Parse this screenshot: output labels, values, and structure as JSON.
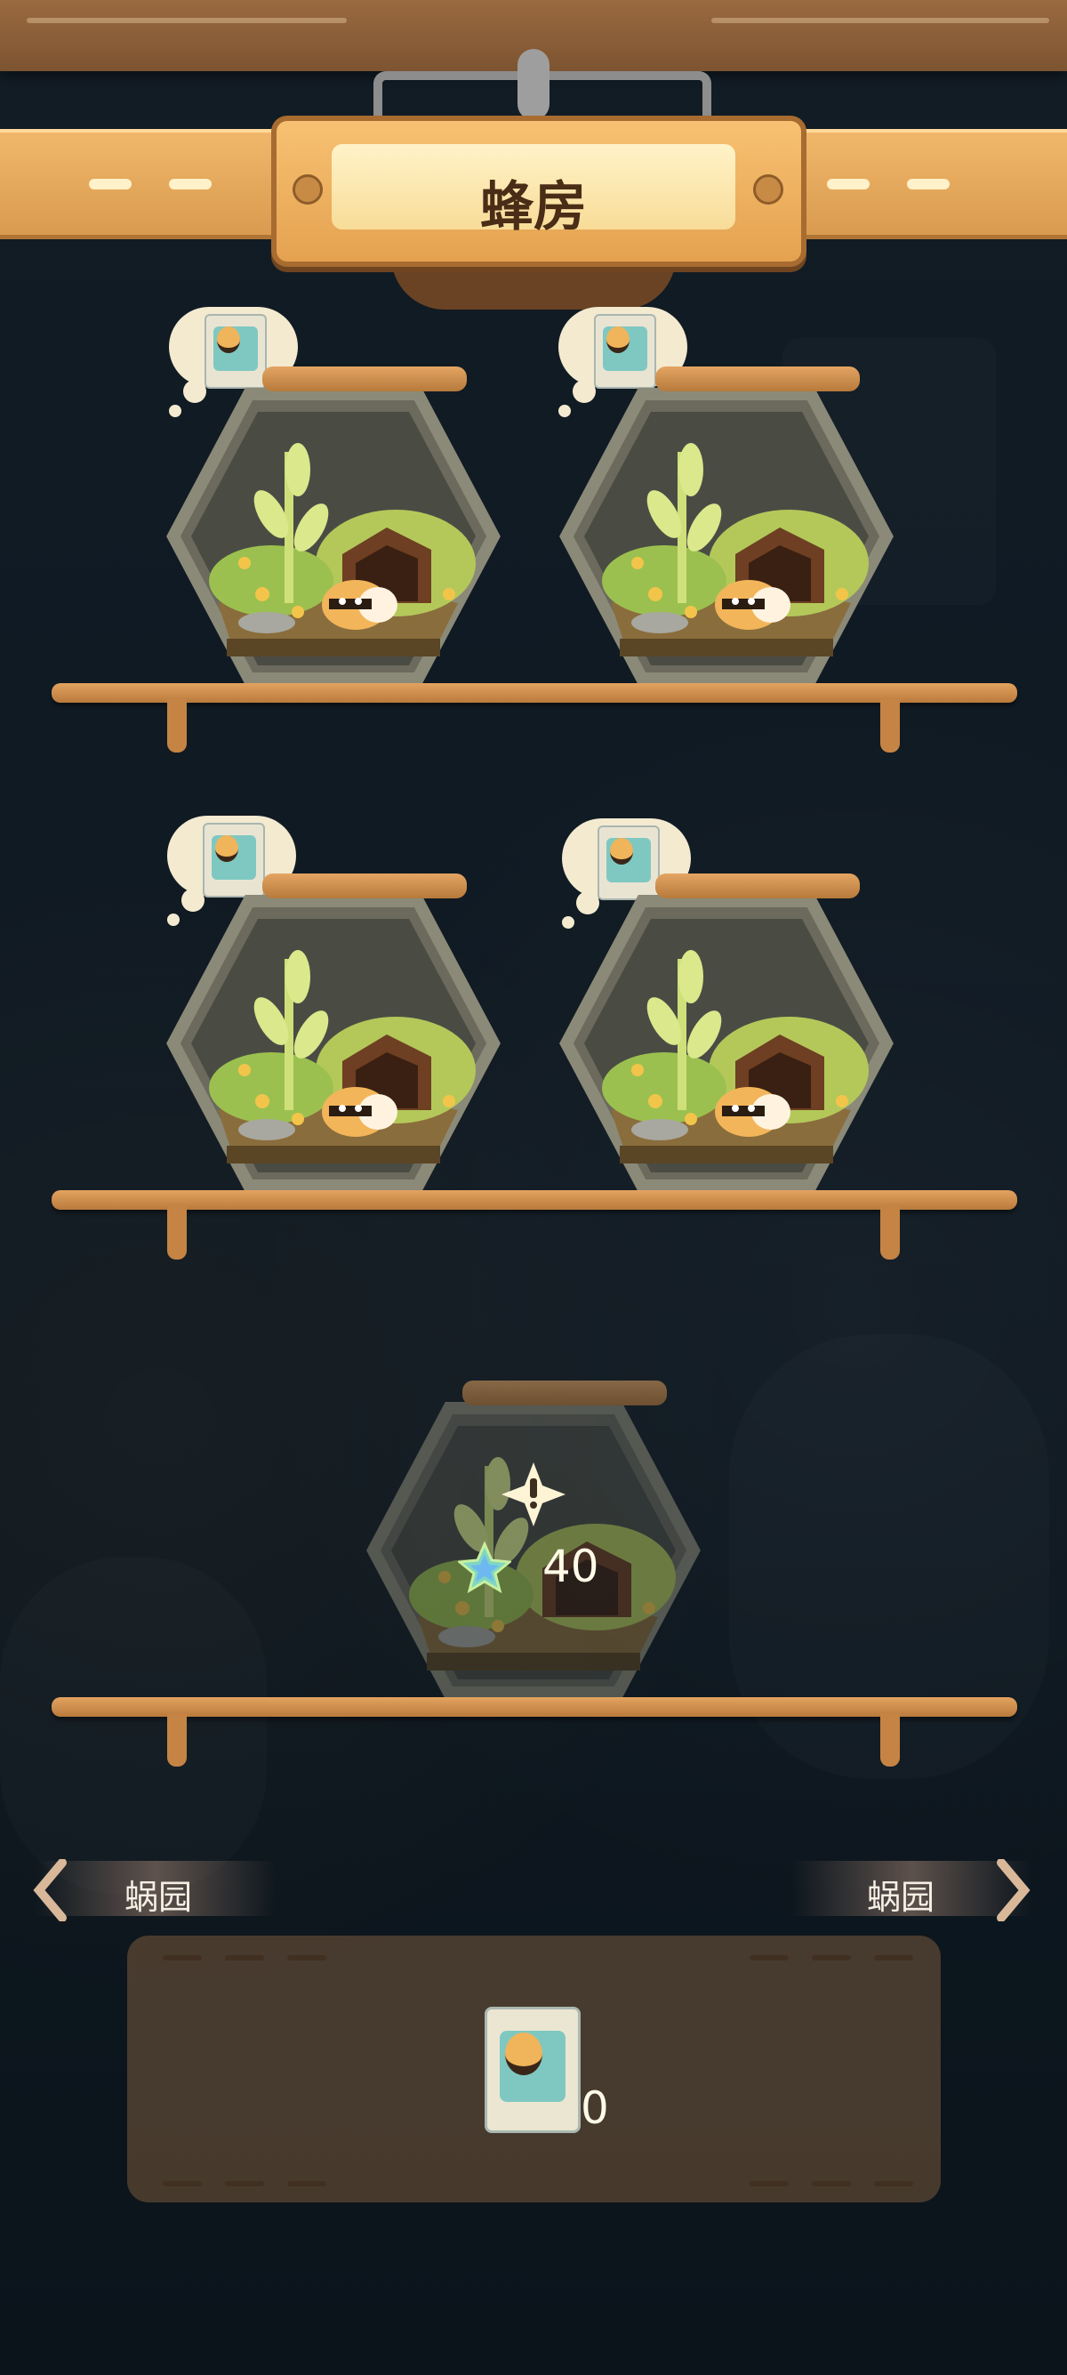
{
  "header": {
    "title": "蜂房"
  },
  "shelves": [
    {
      "slots": [
        {
          "state": "occupied",
          "resident": "bee"
        },
        {
          "state": "occupied",
          "resident": "bee"
        }
      ]
    },
    {
      "slots": [
        {
          "state": "occupied",
          "resident": "bee"
        },
        {
          "state": "occupied",
          "resident": "bee"
        }
      ]
    },
    {
      "slots": [
        {
          "state": "locked",
          "unlock_cost": "40",
          "cost_icon": "star-gem-icon"
        }
      ]
    }
  ],
  "nav": {
    "prev_label": "蜗园",
    "next_label": "蜗园"
  },
  "inventory": {
    "item_icon": "bee-food-pack-icon",
    "count": "0"
  },
  "colors": {
    "wood": "#e3a360",
    "plate": "#f8dc98",
    "bg": "#0f1820"
  }
}
